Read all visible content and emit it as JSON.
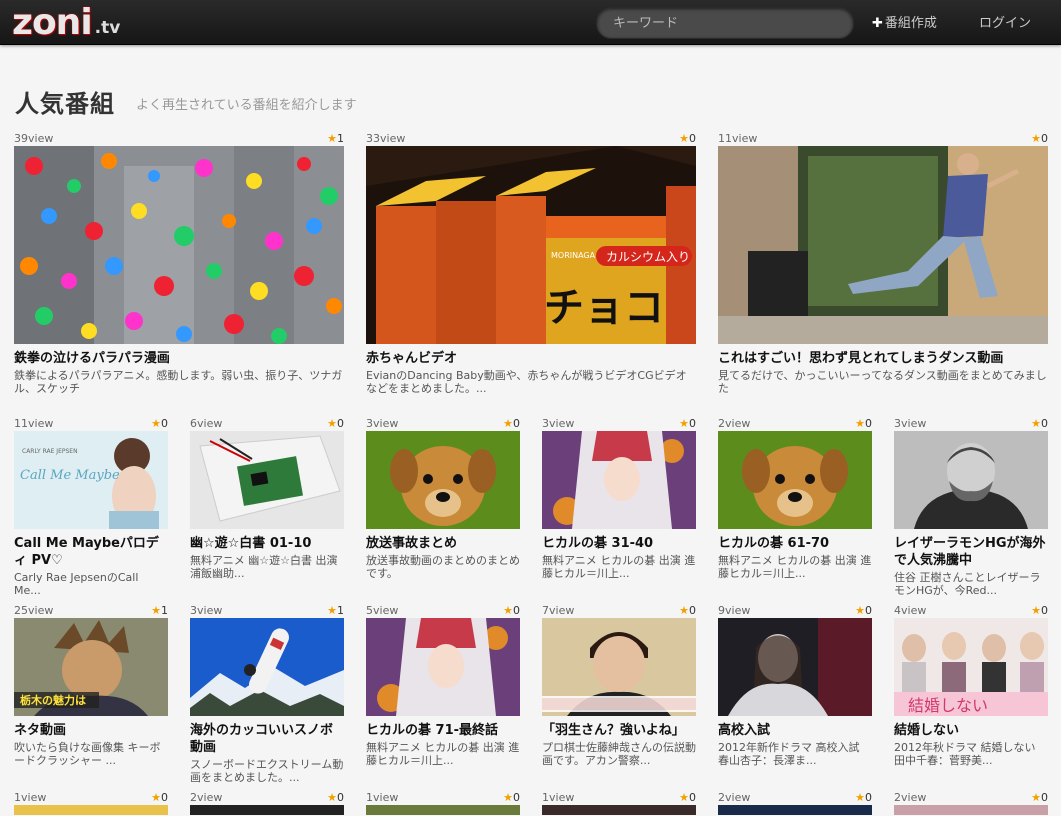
{
  "header": {
    "logo_main": "zoni",
    "logo_tld": ".tv",
    "search_placeholder": "キーワード",
    "create_label": "番組作成",
    "login_label": "ログイン"
  },
  "page": {
    "title": "人気番組",
    "subtitle": "よく再生されている番組を紹介します"
  },
  "cards": [
    {
      "views": "39view",
      "stars": "1",
      "title": "鉄拳の泣けるパラパラ漫画",
      "desc": "鉄拳によるパラパラアニメ。感動します。弱い虫、振り子、ツナガル、スケッチ"
    },
    {
      "views": "33view",
      "stars": "0",
      "title": "赤ちゃんビデオ",
      "desc": "EvianのDancing Baby動画や、赤ちゃんが戦うビデオCGビデオなどをまとめました。..."
    },
    {
      "views": "11view",
      "stars": "0",
      "title": "これはすごい！思わず見とれてしまうダンス動画",
      "desc": "見てるだけで、かっこいいーってなるダンス動画をまとめてみました"
    },
    {
      "views": "11view",
      "stars": "0",
      "title": "Call Me Maybeパロディ PV♡",
      "desc": "Carly Rae JepsenのCall Me..."
    },
    {
      "views": "6view",
      "stars": "0",
      "title": "幽☆遊☆白書 01-10",
      "desc": "無料アニメ 幽☆遊☆白書 出演 浦飯幽助..."
    },
    {
      "views": "3view",
      "stars": "0",
      "title": "放送事故まとめ",
      "desc": "放送事故動画のまとめのまとめです。"
    },
    {
      "views": "3view",
      "stars": "0",
      "title": "ヒカルの碁 31-40",
      "desc": "無料アニメ ヒカルの碁 出演 進藤ヒカル＝川上..."
    },
    {
      "views": "2view",
      "stars": "0",
      "title": "ヒカルの碁 61-70",
      "desc": "無料アニメ ヒカルの碁 出演 進藤ヒカル＝川上..."
    },
    {
      "views": "3view",
      "stars": "0",
      "title": "レイザーラモンHGが海外で人気沸騰中",
      "desc": "住谷 正樹さんことレイザーラモンHGが、今Red..."
    },
    {
      "views": "25view",
      "stars": "1",
      "title": "ネタ動画",
      "desc": "吹いたら負けな画像集 キーボードクラッシャー ..."
    },
    {
      "views": "3view",
      "stars": "1",
      "title": "海外のカッコいいスノボ動画",
      "desc": "スノーボードエクストリーム動画をまとめました。..."
    },
    {
      "views": "5view",
      "stars": "0",
      "title": "ヒカルの碁 71-最終話",
      "desc": "無料アニメ ヒカルの碁 出演 進藤ヒカル＝川上..."
    },
    {
      "views": "7view",
      "stars": "0",
      "title": "「羽生さん？強いよね」",
      "desc": "プロ棋士佐藤紳哉さんの伝説動画です。アカン警察..."
    },
    {
      "views": "9view",
      "stars": "0",
      "title": "高校入試",
      "desc": "2012年新作ドラマ 高校入試 春山杏子：長澤ま..."
    },
    {
      "views": "4view",
      "stars": "0",
      "title": "結婚しない",
      "desc": "2012年秋ドラマ 結婚しない 田中千春：菅野美..."
    },
    {
      "views": "1view",
      "stars": "0"
    },
    {
      "views": "2view",
      "stars": "0"
    },
    {
      "views": "1view",
      "stars": "0"
    },
    {
      "views": "1view",
      "stars": "0"
    },
    {
      "views": "2view",
      "stars": "0"
    },
    {
      "views": "2view",
      "stars": "0"
    }
  ],
  "thumb_texts": {
    "callme_label": "Call Me Maybe",
    "callme_top": "CARLY RAE JEPSEN",
    "choco_label": "チョコ",
    "choco_brand": "MORINAGA",
    "choco_tag": "カルシウム入り",
    "neta_caption": "栃木の魅力は",
    "kekkon_caption": "結婚しない"
  }
}
